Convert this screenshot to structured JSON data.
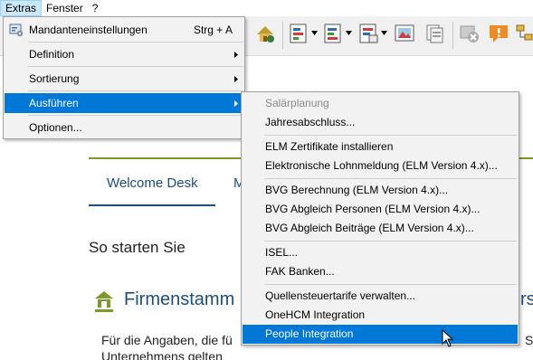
{
  "menubar": {
    "items": [
      {
        "label": "Extras"
      },
      {
        "label": "Fenster"
      },
      {
        "label": "?"
      }
    ]
  },
  "extras_menu": {
    "items": [
      {
        "label": "Mandanteneinstellungen",
        "shortcut": "Strg + A",
        "icon": "settings-icon"
      },
      {
        "label": "Definition",
        "submenu": true
      },
      {
        "label": "Sortierung",
        "submenu": true
      },
      {
        "label": "Ausführen",
        "submenu": true,
        "highlighted": true
      },
      {
        "label": "Optionen..."
      }
    ]
  },
  "run_submenu": {
    "items": [
      {
        "label": "Salärplanung",
        "disabled": true
      },
      {
        "label": "Jahresabschluss..."
      },
      {
        "label": "ELM Zertifikate installieren"
      },
      {
        "label": "Elektronische Lohnmeldung (ELM Version 4.x)..."
      },
      {
        "label": "BVG Berechnung (ELM Version 4.x)..."
      },
      {
        "label": "BVG Abgleich Personen (ELM Version 4.x)..."
      },
      {
        "label": "BVG Abgleich Beiträge (ELM Version 4.x)..."
      },
      {
        "label": "ISEL..."
      },
      {
        "label": "FAK Banken..."
      },
      {
        "label": "Quellensteuertarife verwalten..."
      },
      {
        "label": "OneHCM Integration"
      },
      {
        "label": "People Integration",
        "highlighted": true
      }
    ]
  },
  "content": {
    "tab_welcome": "Welcome Desk",
    "tab_next": "M",
    "heading": "So starten Sie",
    "firm_title": "Firmenstamm",
    "firm_title_right": "rs",
    "para_line1": "Für die Angaben, die fü",
    "para_line2": "Unternehmens gelten",
    "para_right": "S"
  },
  "colors": {
    "highlight": "#0078d7",
    "menu_bg": "#f2f2f2",
    "brand_blue": "#1d4e7a",
    "accent_green": "#7a9b2a"
  }
}
